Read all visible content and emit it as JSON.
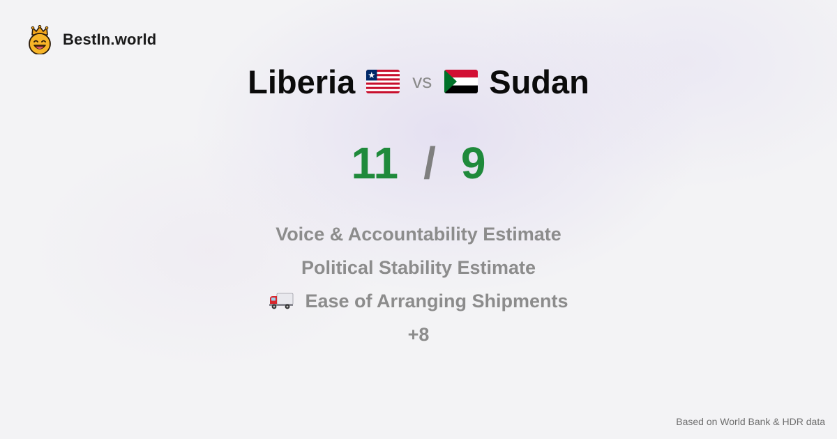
{
  "brand": {
    "name": "BestIn.world",
    "icon": "crowned-smiley-icon"
  },
  "comparison": {
    "left_country": "Liberia",
    "left_flag": "liberia-flag-icon",
    "vs_label": "vs",
    "right_country": "Sudan",
    "right_flag": "sudan-flag-icon"
  },
  "scores": {
    "left": "11",
    "separator": "/",
    "right": "9",
    "color": "#1f8a3b"
  },
  "metrics": [
    {
      "label": "Voice & Accountability Estimate"
    },
    {
      "label": "Political Stability Estimate"
    },
    {
      "label": "Ease of Arranging Shipments",
      "icon": "delivery-truck-icon"
    },
    {
      "label": "+8"
    }
  ],
  "footer": {
    "source": "Based on World Bank & HDR data"
  }
}
